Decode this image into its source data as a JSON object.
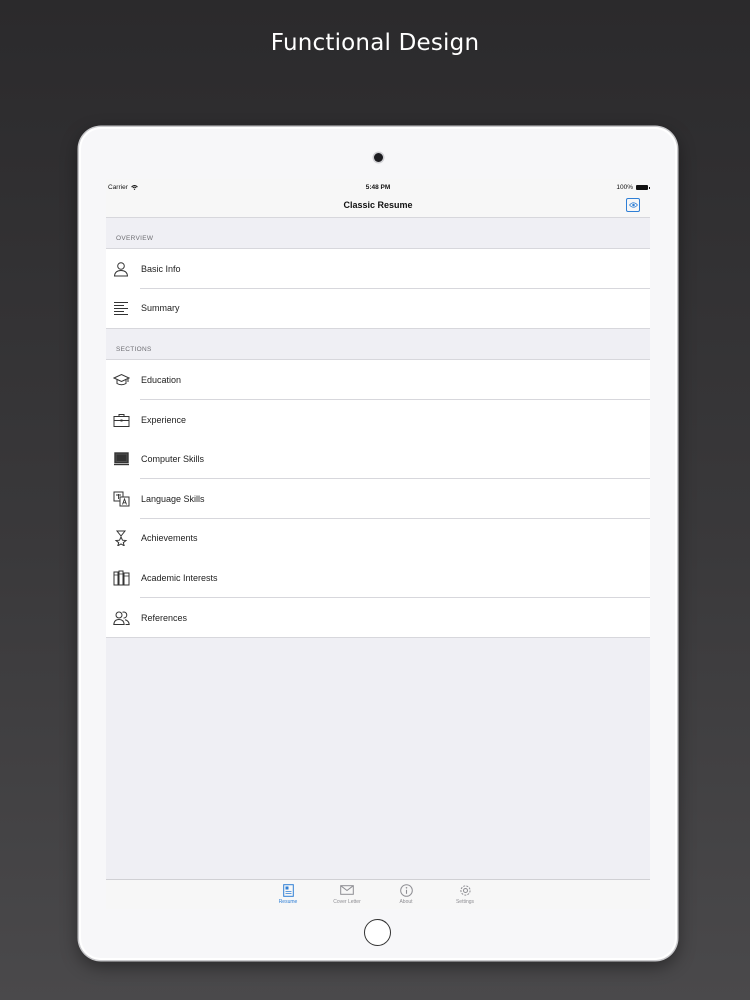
{
  "promo": {
    "headline": "Functional Design"
  },
  "status_bar": {
    "carrier": "Carrier",
    "time": "5:48 PM",
    "battery": "100%"
  },
  "nav": {
    "title": "Classic Resume",
    "preview_icon": "eye-icon"
  },
  "overview": {
    "header": "OVERVIEW",
    "items": [
      {
        "label": "Basic Info",
        "icon": "person-icon"
      },
      {
        "label": "Summary",
        "icon": "text-lines-icon"
      }
    ]
  },
  "sections": {
    "header": "SECTIONS",
    "items": [
      {
        "label": "Education",
        "icon": "graduation-cap-icon"
      },
      {
        "label": "Experience",
        "icon": "briefcase-icon"
      },
      {
        "label": "Computer Skills",
        "icon": "computer-icon"
      },
      {
        "label": "Language Skills",
        "icon": "translate-icon"
      },
      {
        "label": "Achievements",
        "icon": "trophy-icon"
      },
      {
        "label": "Academic Interests",
        "icon": "books-icon"
      },
      {
        "label": "References",
        "icon": "people-icon"
      }
    ]
  },
  "tabbar": {
    "active": "Resume",
    "tabs": [
      {
        "label": "Resume",
        "icon": "resume-icon"
      },
      {
        "label": "Cover Letter",
        "icon": "envelope-icon"
      },
      {
        "label": "About",
        "icon": "info-icon"
      },
      {
        "label": "Settings",
        "icon": "gear-icon"
      }
    ]
  },
  "colors": {
    "accent": "#2f7fd6",
    "background": "#efeff4",
    "row": "#ffffff"
  }
}
